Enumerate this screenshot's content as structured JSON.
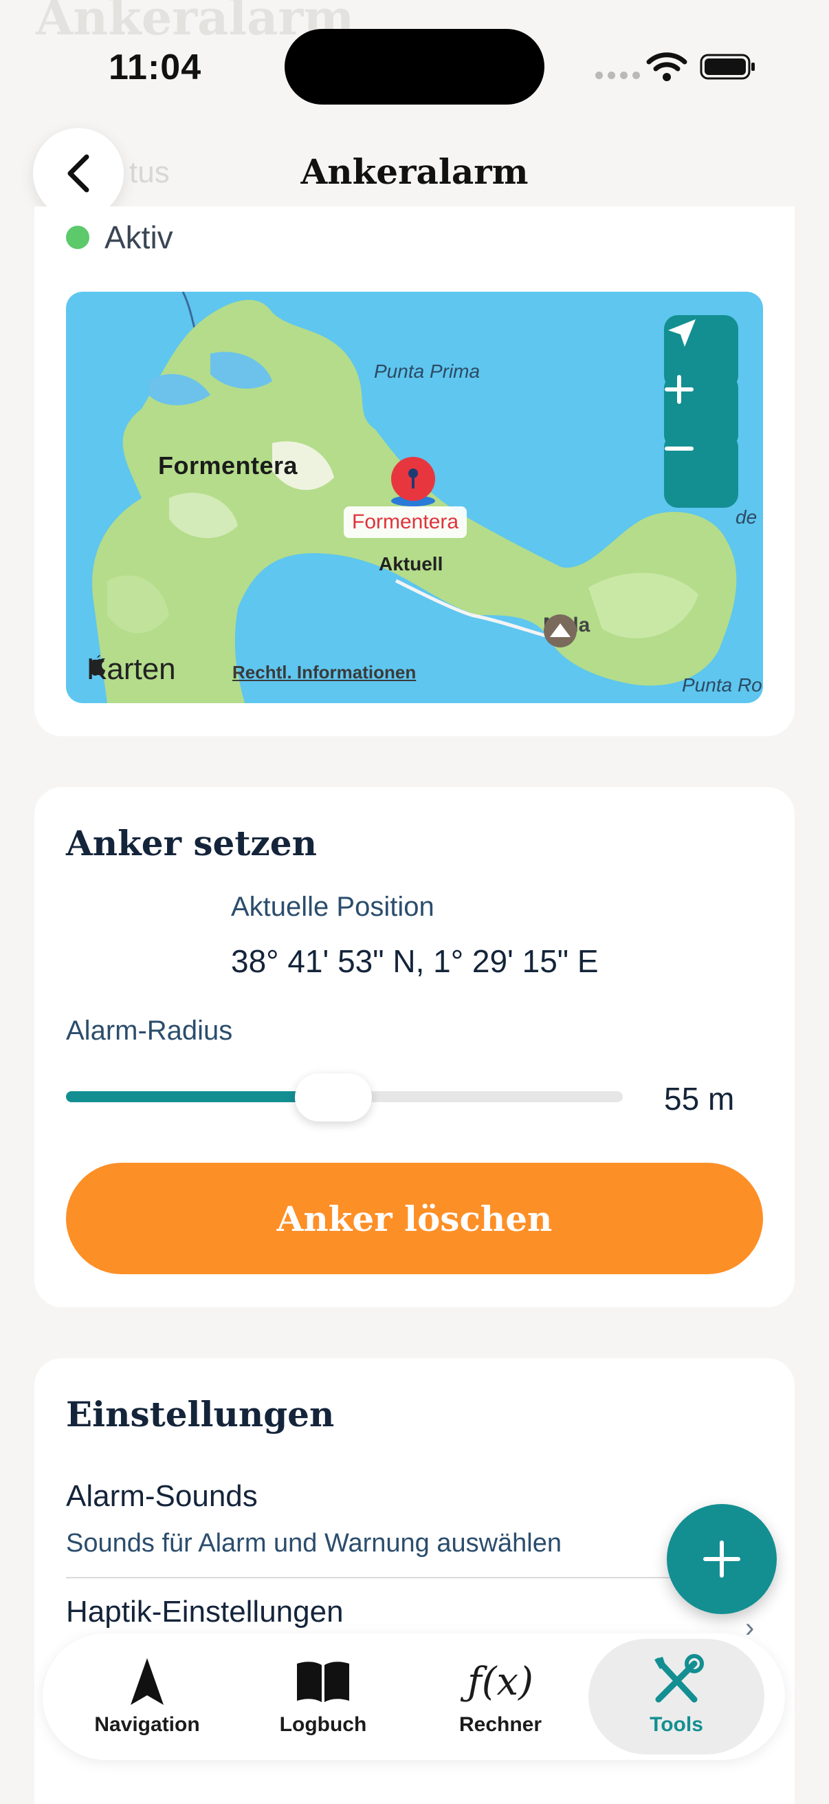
{
  "status_bar": {
    "time": "11:04"
  },
  "header": {
    "ghost_title": "Ankeralarm",
    "title": "Ankeralarm",
    "ghost_status": "tus"
  },
  "status": {
    "label": "Aktiv",
    "color": "#5cc96b"
  },
  "map": {
    "labels": {
      "island": "Formentera",
      "punta_prima": "Punta Prima",
      "punta_r": "Punta Ro",
      "de": "de",
      "current": "Aktuell",
      "mola": "Mola",
      "pin": "Formentera"
    },
    "brand": "Karten",
    "legal": "Rechtl. Informationen"
  },
  "anchor": {
    "title": "Anker setzen",
    "position_label": "Aktuelle Position",
    "position_value": "38° 41' 53\" N, 1° 29' 15\" E",
    "radius_label": "Alarm-Radius",
    "radius_value": "55 m",
    "radius_fraction": 0.48,
    "delete_label": "Anker löschen"
  },
  "settings": {
    "title": "Einstellungen",
    "items": [
      {
        "title": "Alarm-Sounds",
        "subtitle": "Sounds für Alarm und Warnung auswählen"
      },
      {
        "title": "Haptik-Einstellungen"
      }
    ]
  },
  "tabbar": {
    "tabs": [
      {
        "label": "Navigation",
        "icon": "navigation-arrow-icon"
      },
      {
        "label": "Logbuch",
        "icon": "book-icon"
      },
      {
        "label": "Rechner",
        "icon": "function-icon",
        "glyph": "ƒ(x)"
      },
      {
        "label": "Tools",
        "icon": "tools-icon",
        "active": true
      }
    ]
  },
  "colors": {
    "accent": "#138f92",
    "primary_button": "#fd8f27",
    "background": "#f6f5f3"
  }
}
